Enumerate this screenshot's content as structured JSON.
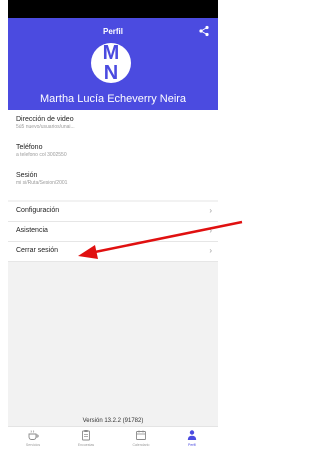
{
  "header": {
    "title": "Perfil",
    "avatar_initial_top": "M",
    "avatar_initial_bottom": "N",
    "user_name": "Martha Lucía Echeverry Neira"
  },
  "info": [
    {
      "label": "Dirección de video",
      "value": "5ú5 nuevo/usuarios/unai..."
    },
    {
      "label": "Teléfono",
      "value": "a telefono col 3002550"
    },
    {
      "label": "Sesión",
      "value": "mi si/Ruta/Sesion/2001"
    }
  ],
  "menu": [
    {
      "label": "Configuración"
    },
    {
      "label": "Asistencia"
    },
    {
      "label": "Cerrar sesión"
    }
  ],
  "version": "Versión 13.2.2 (91782)",
  "nav": [
    {
      "label": "Servicios",
      "icon": "coffee-icon"
    },
    {
      "label": "Encuestas",
      "icon": "clipboard-icon"
    },
    {
      "label": "Calendario",
      "icon": "calendar-icon"
    },
    {
      "label": "Perfil",
      "icon": "person-icon",
      "active": true
    }
  ],
  "colors": {
    "accent": "#4b4be0",
    "annotation_arrow": "#e01010"
  }
}
